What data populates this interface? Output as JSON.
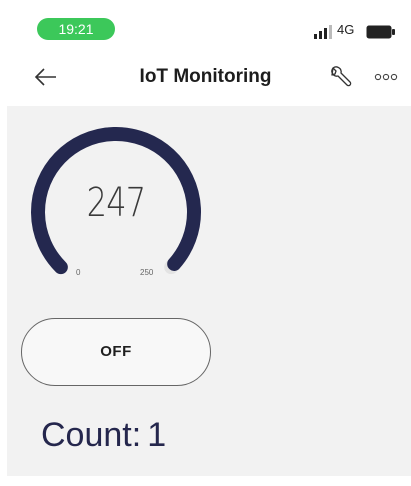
{
  "status_bar": {
    "time": "19:21",
    "network": "4G",
    "signal_icon": "signal-bars-icon",
    "battery_icon": "battery-icon",
    "time_pill_color": "#3cc85a"
  },
  "header": {
    "title": "IoT Monitoring",
    "back_icon": "arrow-left-icon",
    "settings_icon": "wrench-icon",
    "more_icon": "more-dots-icon"
  },
  "gauge": {
    "value": "247",
    "numeric_value": 247,
    "min": "0",
    "max": "250",
    "color": "#24284f"
  },
  "toggle": {
    "label": "OFF"
  },
  "count": {
    "label": "Count:",
    "value": "1"
  }
}
